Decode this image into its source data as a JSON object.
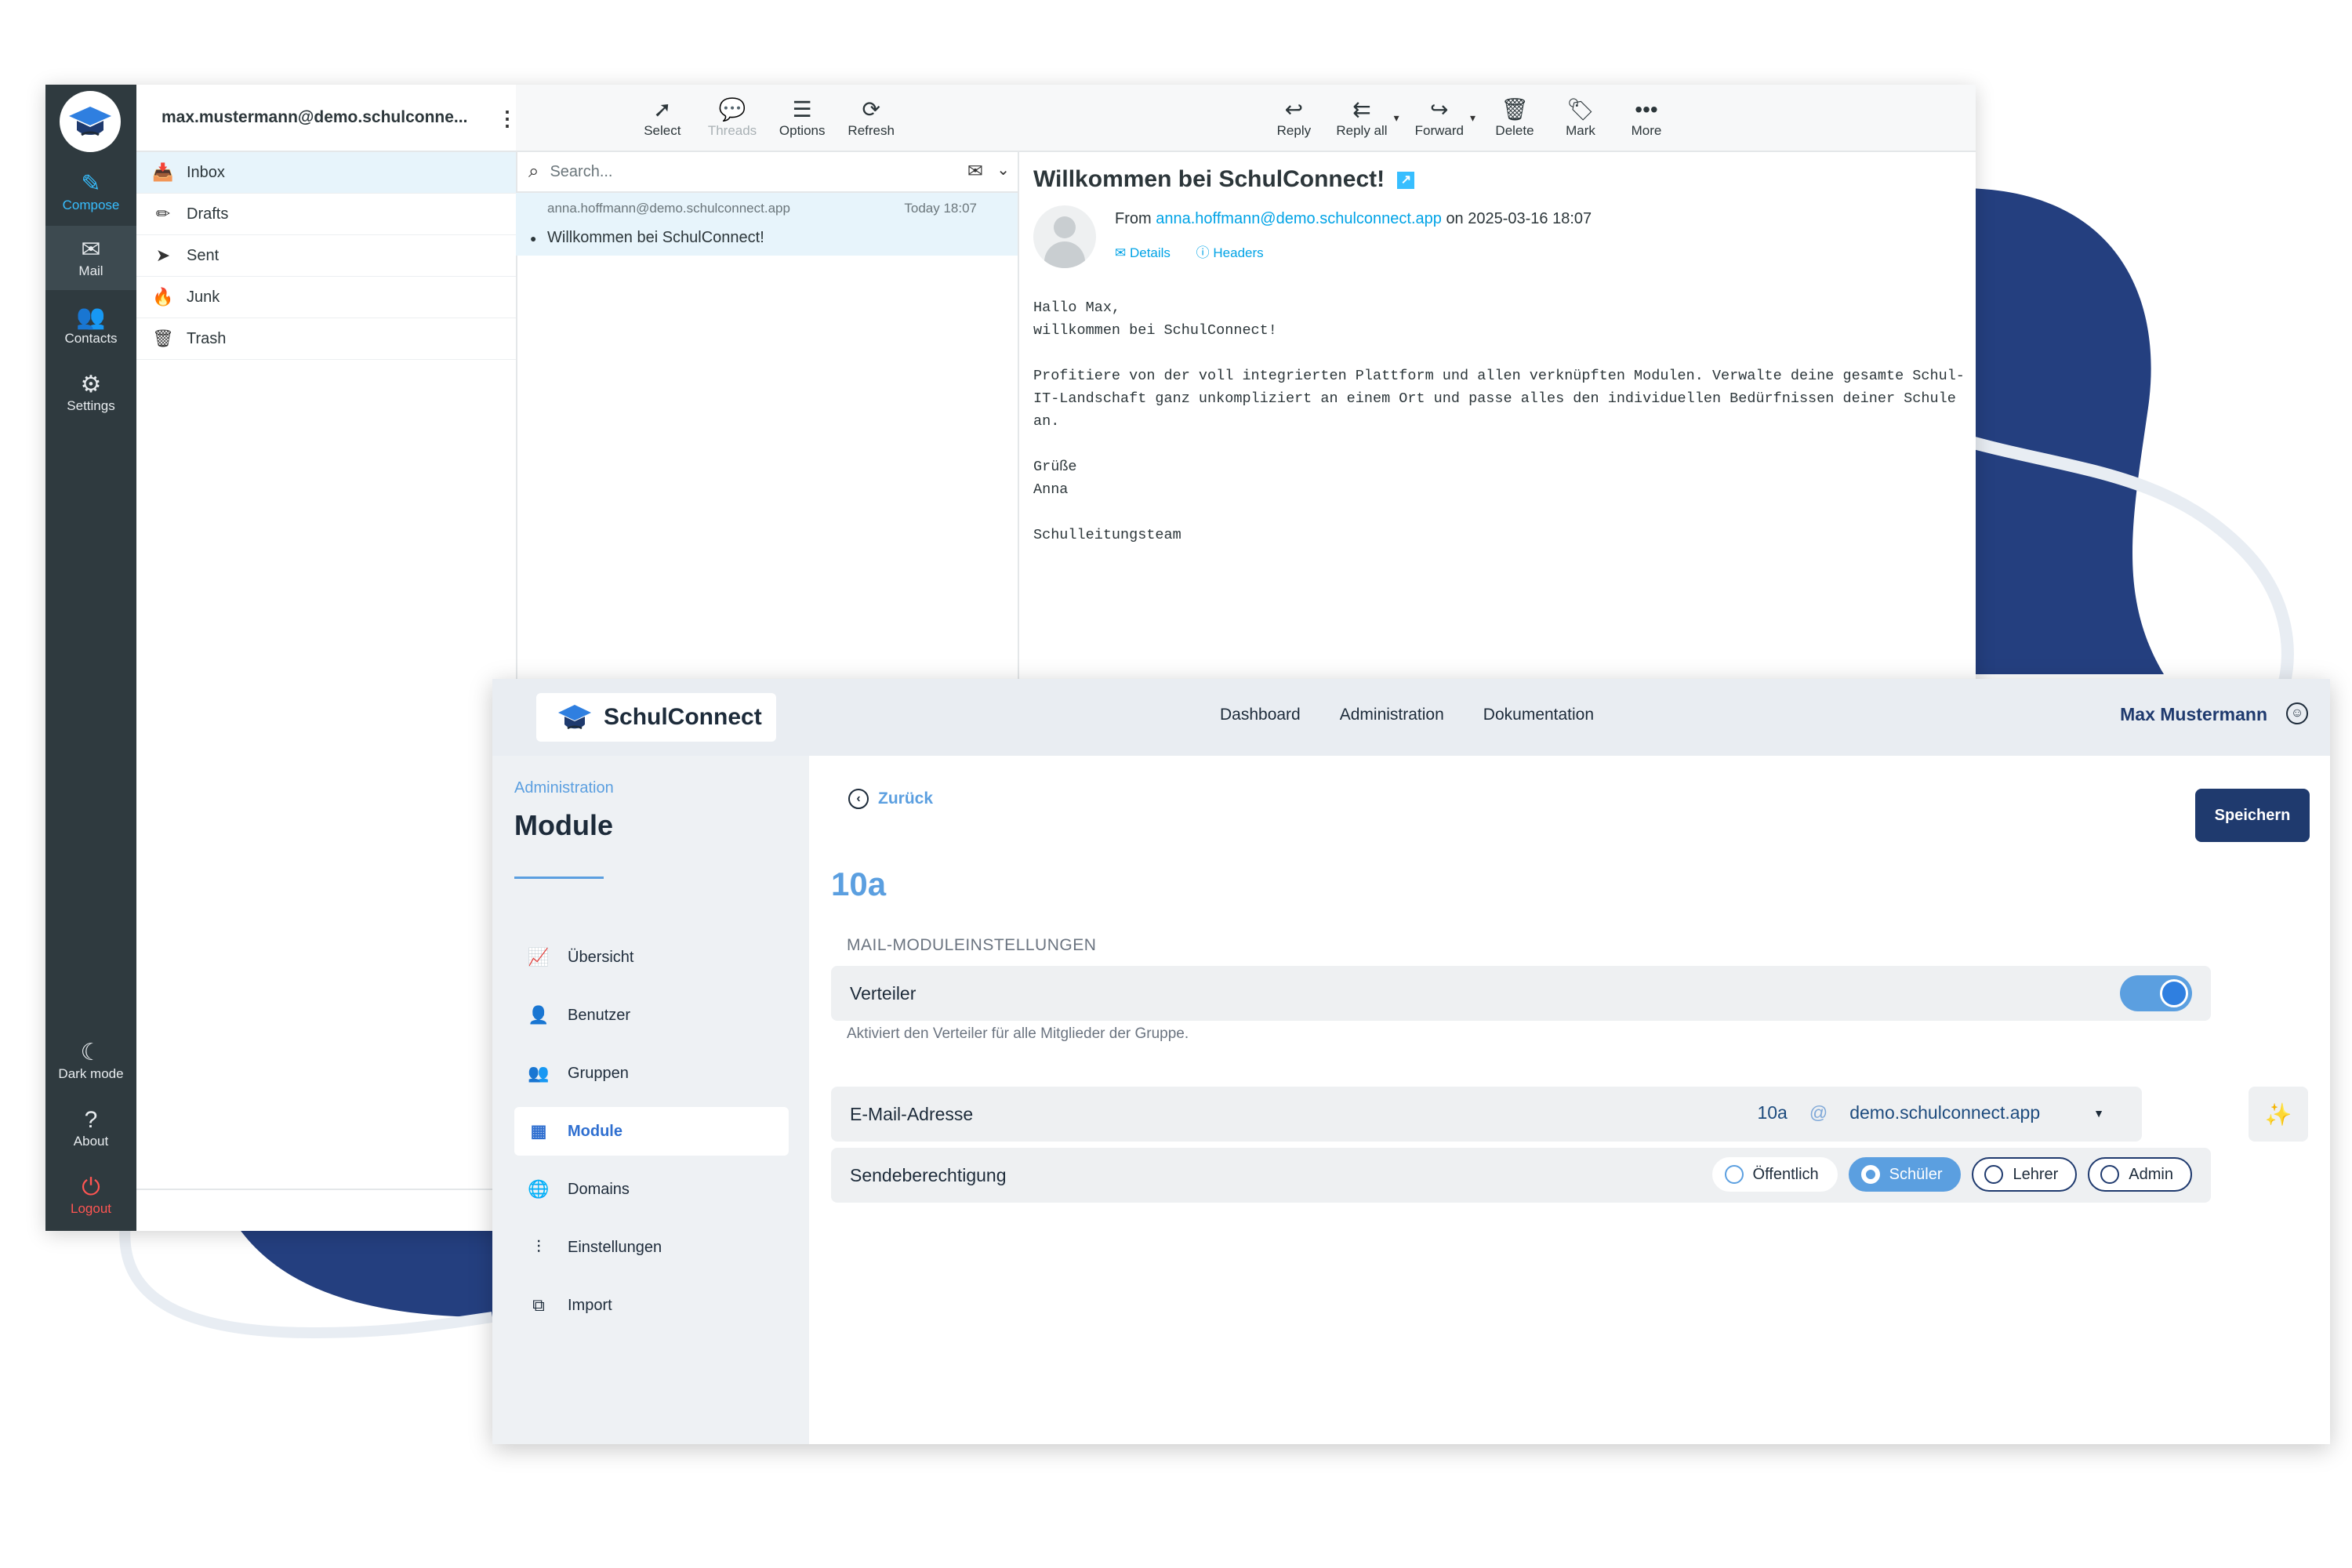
{
  "colors": {
    "rail_bg": "#2f3a3f",
    "accent_blue": "#37beff",
    "link_blue": "#00a3e6",
    "logout_red": "#ff5552",
    "brand_navy": "#1f3a6e",
    "admin_accent": "#5b9fe0",
    "blob_navy": "#243f7f"
  },
  "mail": {
    "account": "max.mustermann@demo.schulconne...",
    "rail": {
      "compose": "Compose",
      "mail": "Mail",
      "contacts": "Contacts",
      "settings": "Settings",
      "dark_mode": "Dark mode",
      "about": "About",
      "logout": "Logout"
    },
    "folders": [
      "Inbox",
      "Drafts",
      "Sent",
      "Junk",
      "Trash"
    ],
    "list_toolbar": {
      "select": "Select",
      "threads": "Threads",
      "options": "Options",
      "refresh": "Refresh"
    },
    "search_placeholder": "Search...",
    "message": {
      "from": "anna.hoffmann@demo.schulconnect.app",
      "date": "Today 18:07",
      "subject": "Willkommen bei SchulConnect!"
    },
    "reader_toolbar": {
      "reply": "Reply",
      "reply_all": "Reply all",
      "forward": "Forward",
      "delete": "Delete",
      "mark": "Mark",
      "more": "More"
    },
    "reader": {
      "subject": "Willkommen bei SchulConnect!",
      "from_label": "From",
      "from_address": "anna.hoffmann@demo.schulconnect.app",
      "on_date": "on 2025-03-16 18:07",
      "details": "Details",
      "headers": "Headers",
      "body": "Hallo Max,\nwillkommen bei SchulConnect!\n\nProfitiere von der voll integrierten Plattform und allen verknüpften Modulen. Verwalte deine gesamte Schul-\nIT-Landschaft ganz unkompliziert an einem Ort und passe alles den individuellen Bedürfnissen deiner Schule\nan.\n\nGrüße\nAnna\n\nSchulleitungsteam"
    }
  },
  "admin": {
    "brand": "SchulConnect",
    "nav": [
      "Dashboard",
      "Administration",
      "Dokumentation"
    ],
    "user": "Max Mustermann",
    "breadcrumb": "Administration",
    "page_title": "Module",
    "sidebar": [
      "Übersicht",
      "Benutzer",
      "Gruppen",
      "Module",
      "Domains",
      "Einstellungen",
      "Import"
    ],
    "sidebar_active": "Module",
    "back": "Zurück",
    "save": "Speichern",
    "group_name": "10a",
    "section_title": "MAIL-MODULEINSTELLUNGEN",
    "verteiler_label": "Verteiler",
    "verteiler_enabled": true,
    "verteiler_hint": "Aktiviert den Verteiler für alle Mitglieder der Gruppe.",
    "email_label": "E-Mail-Adresse",
    "email_local": "10a",
    "email_at": "@",
    "email_domain": "demo.schulconnect.app",
    "send_label": "Sendeberechtigung",
    "send_options": [
      "Öffentlich",
      "Schüler",
      "Lehrer",
      "Admin"
    ],
    "send_selected": "Schüler"
  }
}
